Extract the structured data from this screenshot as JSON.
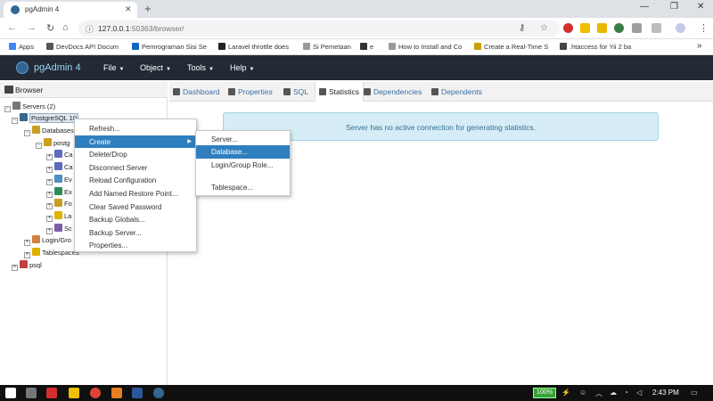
{
  "browser": {
    "tab_title": "pgAdmin 4",
    "tab_close": "✕",
    "new_tab": "+",
    "url_host": "127.0.0.1",
    "url_path": ":50363/browser/",
    "window_min": "—",
    "window_max": "❐",
    "window_close": "✕",
    "bookmarks": [
      {
        "label": "Apps",
        "color": "#4285f4"
      },
      {
        "label": "DevDocs API Docum",
        "color": "#555555"
      },
      {
        "label": "Pemrograman Sisi Se",
        "color": "#1565c0"
      },
      {
        "label": "Laravel throttle does",
        "color": "#222222"
      },
      {
        "label": "Si Pemetaan",
        "color": "#999999"
      },
      {
        "label": "e",
        "color": "#333333"
      },
      {
        "label": "How to Install and Co",
        "color": "#999999"
      },
      {
        "label": "Create a Real-Time S",
        "color": "#c8a000"
      },
      {
        "label": ".htaccess for Yii 2 ba",
        "color": "#444444"
      }
    ],
    "more_bookmarks": "»"
  },
  "navbar": {
    "brand": "pgAdmin 4",
    "menus": [
      "File",
      "Object",
      "Tools",
      "Help"
    ]
  },
  "browser_panel": {
    "title": "Browser",
    "tree": [
      {
        "label": "Servers (2)",
        "exp": "⊟",
        "color": "#777777"
      },
      {
        "label": "PostgreSQL 10",
        "exp": "⊟",
        "color": "#336791"
      },
      {
        "label": "Databases",
        "exp": "⊟",
        "color": "#c8a020"
      },
      {
        "label": "postg",
        "exp": "⊟",
        "color": "#c8a020"
      },
      {
        "label": "Ca",
        "exp": "⊞",
        "color": "#5c6bc0"
      },
      {
        "label": "Ca",
        "exp": "⊞",
        "color": "#5c6bc0"
      },
      {
        "label": "Ev",
        "exp": "⊞",
        "color": "#4a90c0"
      },
      {
        "label": "Ex",
        "exp": "⊞",
        "color": "#2e8b57"
      },
      {
        "label": "Fo",
        "exp": "⊞",
        "color": "#c8a020"
      },
      {
        "label": "La",
        "exp": "⊞",
        "color": "#e0b000"
      },
      {
        "label": "Sc",
        "exp": "⊞",
        "color": "#7b5ea7"
      },
      {
        "label": "Login/Gro",
        "exp": "⊞",
        "color": "#d08040"
      },
      {
        "label": "Tablespaces",
        "exp": "⊞",
        "color": "#e0b000"
      },
      {
        "label": "psql",
        "exp": "⊞",
        "color": "#c04040"
      }
    ]
  },
  "tabs": [
    {
      "label": "Dashboard",
      "active": false
    },
    {
      "label": "Properties",
      "active": false
    },
    {
      "label": "SQL",
      "active": false
    },
    {
      "label": "Statistics",
      "active": true
    },
    {
      "label": "Dependencies",
      "active": false
    },
    {
      "label": "Dependents",
      "active": false
    }
  ],
  "alert": "Server has no active connection for generating statistics.",
  "context_menu": {
    "items": [
      "Refresh...",
      "Create",
      "Delete/Drop",
      "Disconnect Server",
      "Reload Configuration",
      "Add Named Restore Point...",
      "Clear Saved Password",
      "Backup Globals...",
      "Backup Server...",
      "Properties..."
    ],
    "highlighted": "Create",
    "submenu_arrow": "▶"
  },
  "submenu": {
    "items": [
      "Server...",
      "Database...",
      "Login/Group Role...",
      "Tablespace..."
    ],
    "highlighted": "Database..."
  },
  "taskbar": {
    "battery": "100%",
    "time": "2:43 PM"
  }
}
